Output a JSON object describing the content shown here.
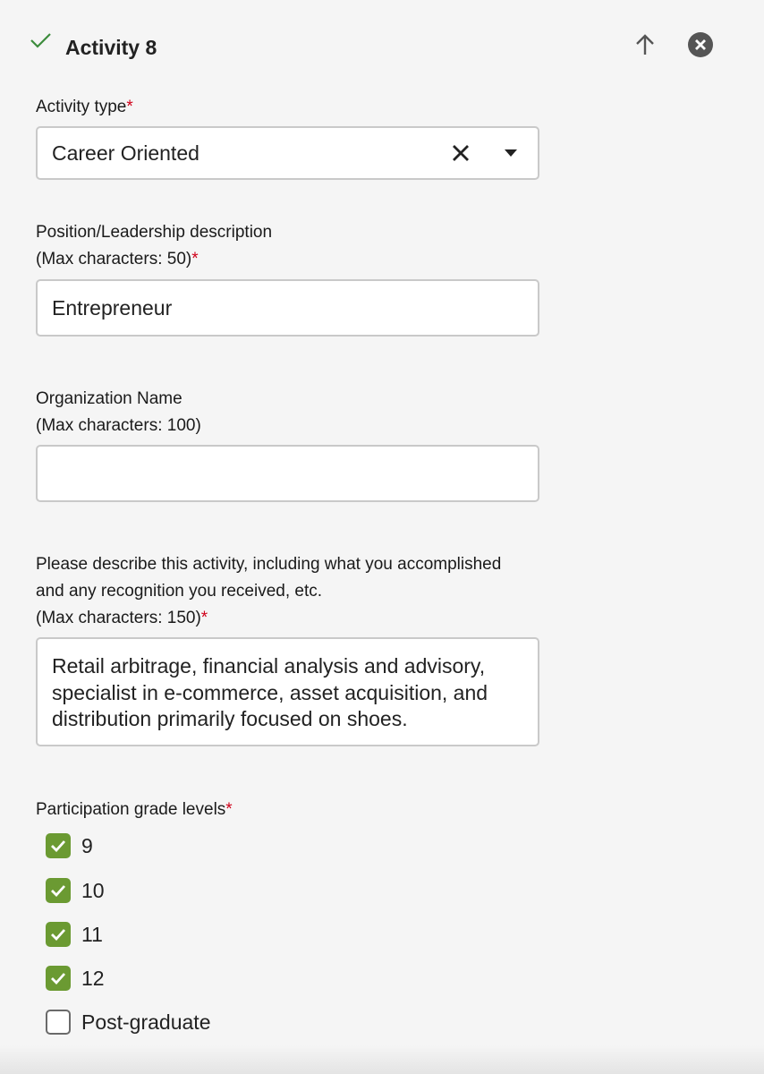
{
  "header": {
    "title": "Activity 8",
    "status_icon": "checkmark-icon",
    "accent_color": "#3c8c3c"
  },
  "actions": {
    "move_up_icon": "arrow-up-icon",
    "remove_icon": "close-circle-icon"
  },
  "fields": {
    "activity_type": {
      "label": "Activity type",
      "required_mark": "*",
      "value": "Career Oriented"
    },
    "position": {
      "label_line1": "Position/Leadership description",
      "label_line2": "(Max characters: 50)",
      "required_mark": "*",
      "value": "Entrepreneur"
    },
    "organization": {
      "label_line1": "Organization Name",
      "label_line2": "(Max characters: 100)",
      "value": ""
    },
    "description": {
      "label_line1": "Please describe this activity, including what you accomplished",
      "label_line2": "and any recognition you received, etc.",
      "label_line3": "(Max characters: 150)",
      "required_mark": "*",
      "value": "Retail arbitrage, financial analysis and advisory,\nspecialist in e-commerce, asset acquisition, and\ndistribution primarily focused on shoes."
    },
    "grade_levels": {
      "label": "Participation grade levels",
      "required_mark": "*",
      "options": [
        {
          "label": "9",
          "checked": true
        },
        {
          "label": "10",
          "checked": true
        },
        {
          "label": "11",
          "checked": true
        },
        {
          "label": "12",
          "checked": true
        },
        {
          "label": "Post-graduate",
          "checked": false
        }
      ]
    }
  },
  "colors": {
    "checkbox_checked": "#6b9a32",
    "required": "#d0021b"
  }
}
